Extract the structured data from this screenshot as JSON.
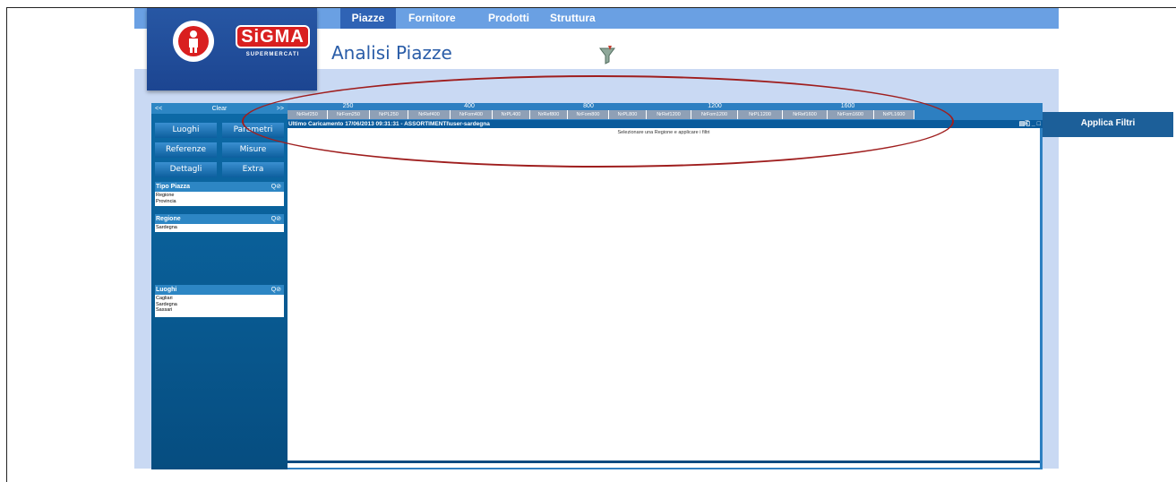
{
  "nav": {
    "tabs": [
      {
        "label": "Piazze",
        "active": true
      },
      {
        "label": "Fornitore"
      },
      {
        "label": "Prodotti"
      },
      {
        "label": "Struttura"
      }
    ]
  },
  "page": {
    "title": "Analisi Piazze"
  },
  "logo": {
    "word": "SiGMA",
    "sub": "SUPERMERCATI"
  },
  "sidebar": {
    "top": {
      "prev": "<<",
      "clear": "Clear",
      "next": ">>"
    },
    "buttons": [
      "Luoghi",
      "Parametri",
      "Referenze",
      "Misure",
      "Dettagli",
      "Extra"
    ],
    "panels": [
      {
        "title": "Tipo Piazza",
        "items": [
          "Regione",
          "Provincia"
        ]
      },
      {
        "title": "Regione",
        "items": [
          "Sardegna"
        ]
      },
      {
        "title": "Luoghi",
        "items": [
          "Cagliari",
          "Sardegna",
          "Sassari"
        ]
      }
    ]
  },
  "grid": {
    "groups": [
      "250",
      "400",
      "800",
      "1200",
      "1600"
    ],
    "columns": [
      "NrRef250",
      "NrFom250",
      "NrPL250",
      "NrRef400",
      "NrFom400",
      "NrPL400",
      "NrRef800",
      "NrFom800",
      "NrPL800",
      "NrRef1200",
      "NrFom1200",
      "NrPL1200",
      "NrRef1600",
      "NrFom1600",
      "NrPL1600"
    ],
    "status": "Ultimo Caricamento 17/06/2013 09:31:31 - ASSORTIMENTI\\user-sardegna",
    "empty_message": "Selezionare una Regione e applicare i filtri"
  },
  "apply_button": "Applica Filtri",
  "colors": {
    "nav": "#6aa0e3",
    "nav_active": "#2f63b5",
    "sidebar": "#0c6aa7",
    "annotation": "#9f1e1e",
    "logo_red": "#d91f1f"
  }
}
